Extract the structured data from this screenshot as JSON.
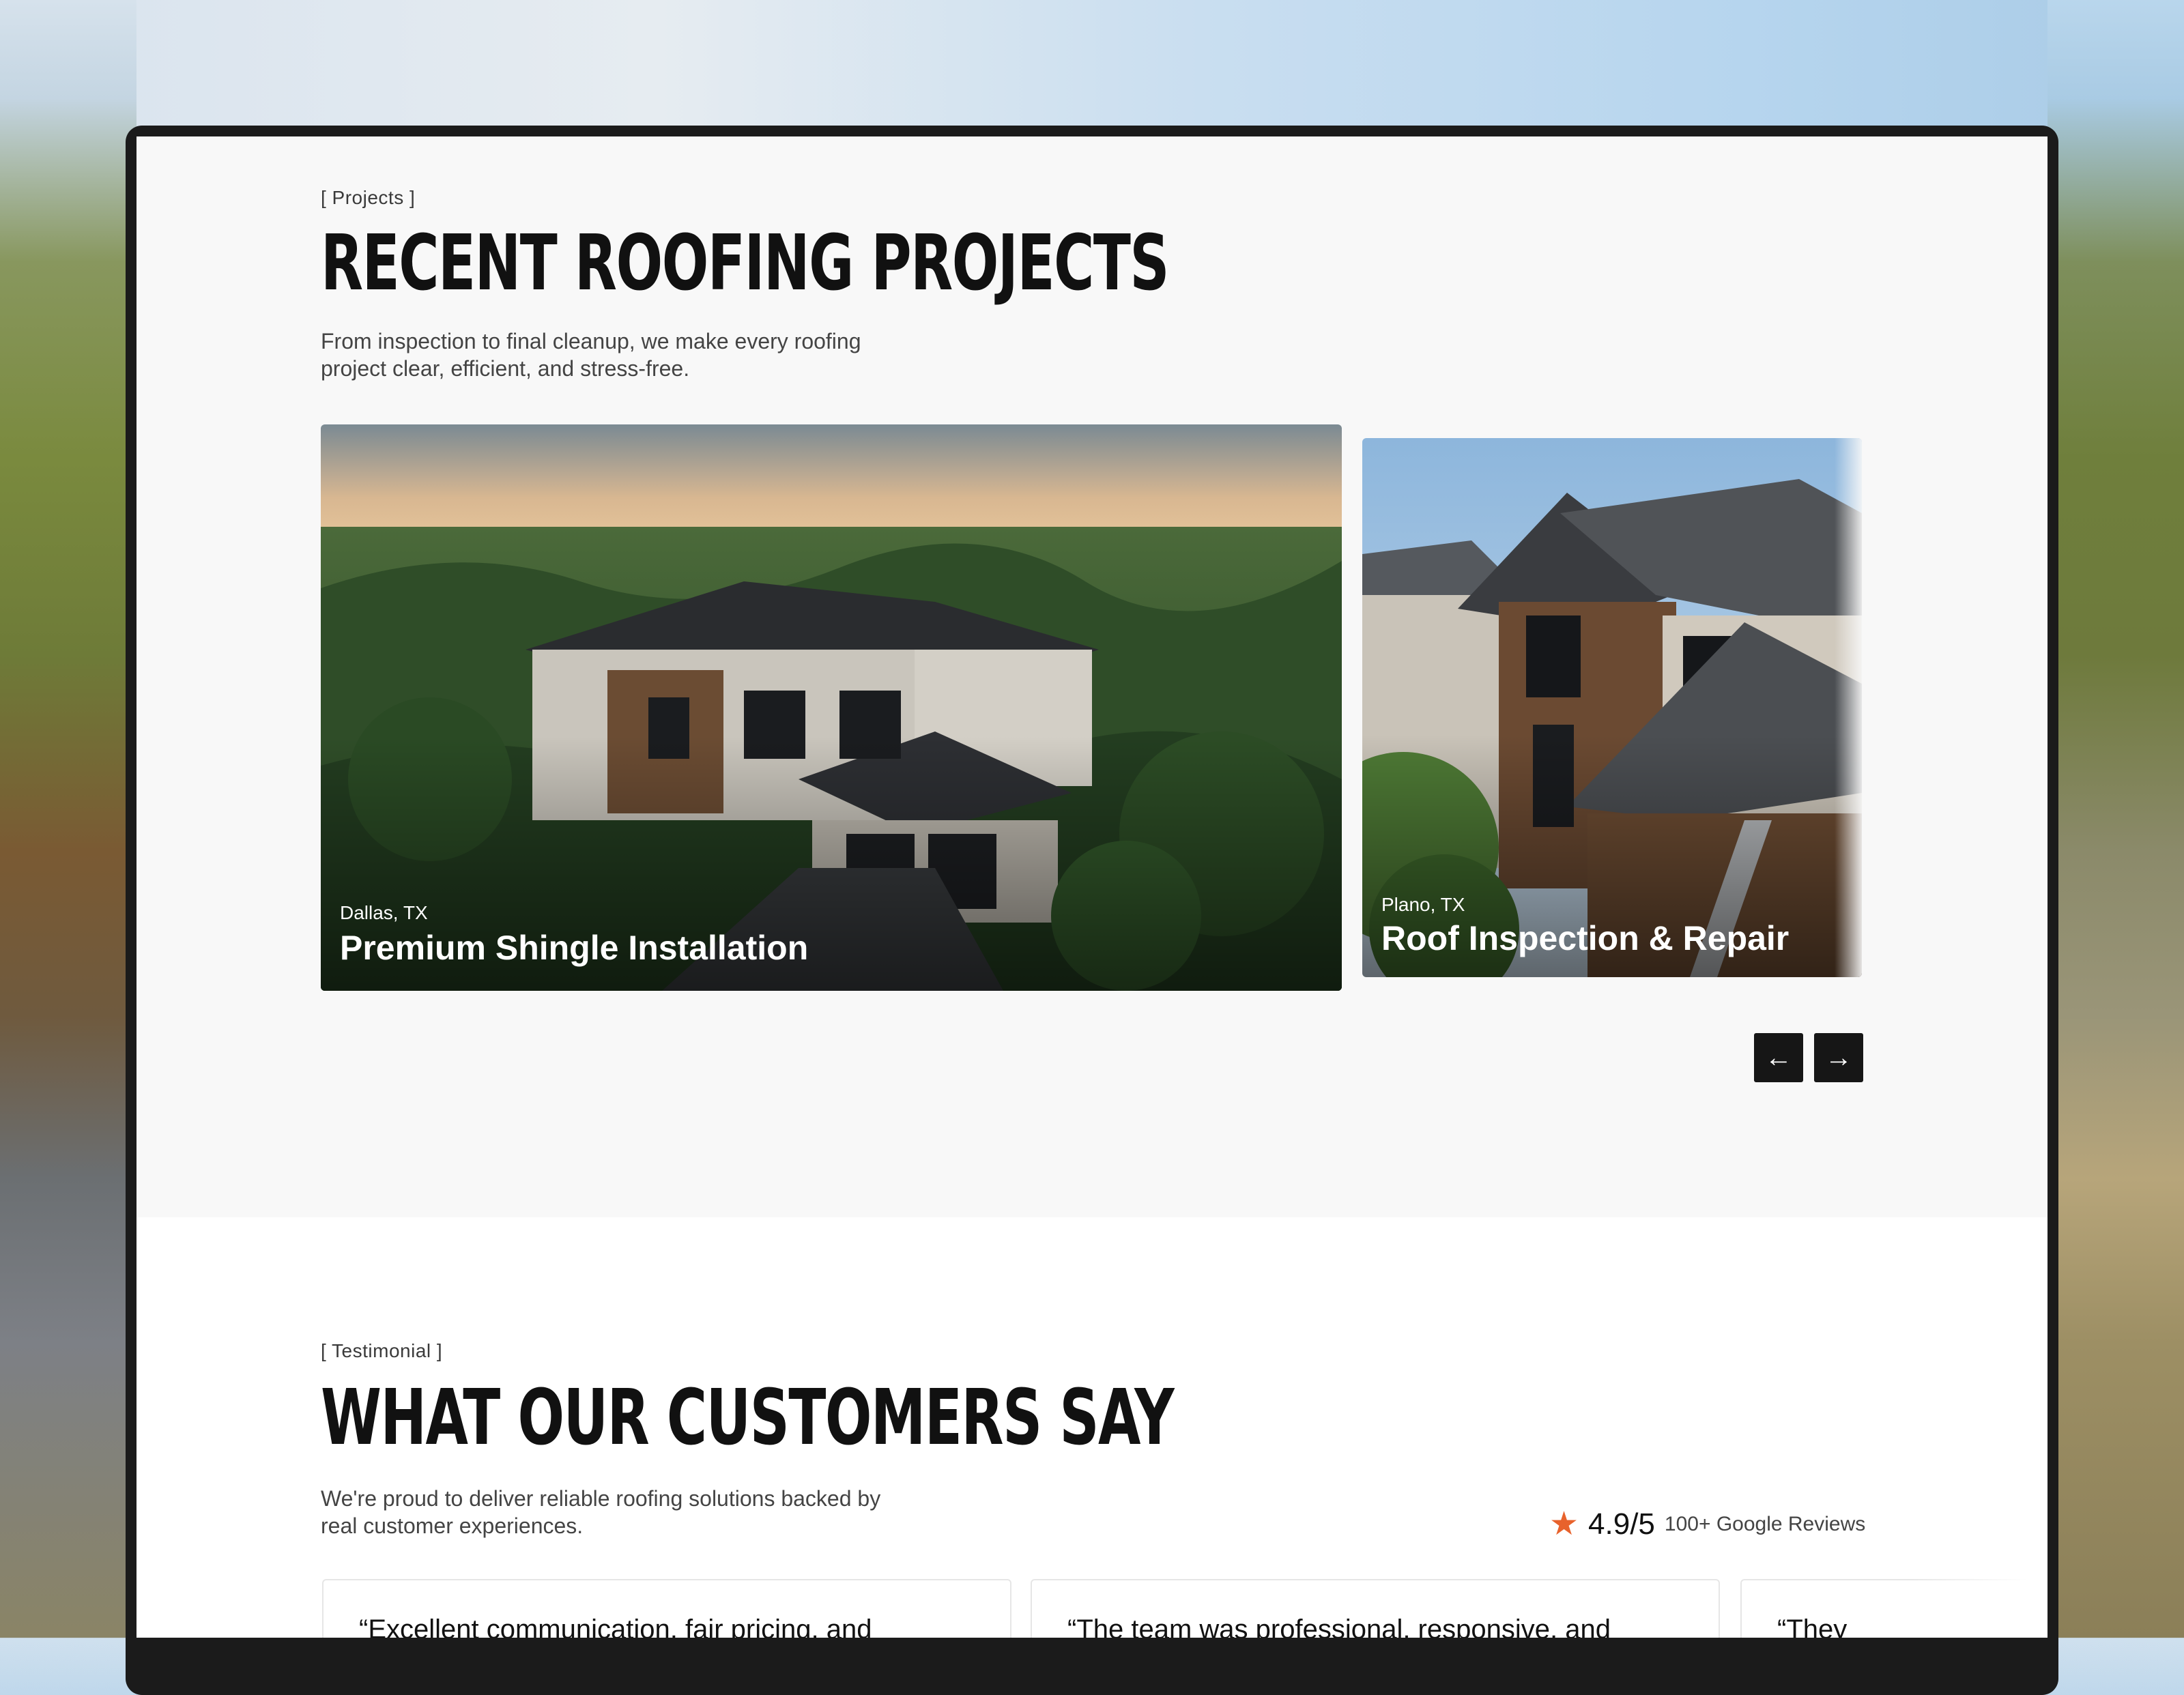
{
  "projects": {
    "eyebrow": "[ Projects ]",
    "title": "RECENT ROOFING PROJECTS",
    "subtitle": "From inspection to final cleanup, we make every roofing project clear, efficient, and stress-free.",
    "cards": [
      {
        "location": "Dallas, TX",
        "title": "Premium Shingle Installation"
      },
      {
        "location": "Plano, TX",
        "title": "Roof Inspection & Repair"
      }
    ],
    "prev_icon": "arrow-left-icon",
    "next_icon": "arrow-right-icon"
  },
  "testimonials": {
    "eyebrow": "[ Testimonial ]",
    "title": "WHAT OUR CUSTOMERS SAY",
    "subtitle": "We're proud to deliver reliable roofing solutions backed by real customer experiences.",
    "rating": {
      "score": "4.9/5",
      "count": "100+ Google Reviews",
      "star_color": "#e8622c"
    },
    "quotes": [
      "“Excellent communication, fair pricing, and",
      "“The team was professional, responsive, and",
      "“They"
    ]
  }
}
